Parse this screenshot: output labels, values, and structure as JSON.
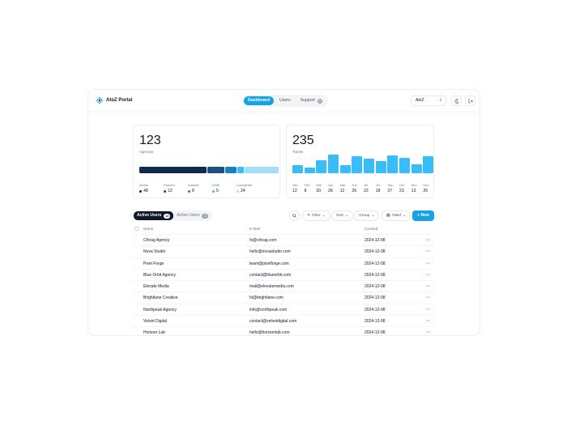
{
  "header": {
    "brand": "AtoZ Portal",
    "nav": [
      {
        "label": "Dashboard",
        "active": true
      },
      {
        "label": "Users",
        "active": false
      },
      {
        "label": "Support",
        "active": false,
        "badge": "3"
      }
    ],
    "org": "AtoZ"
  },
  "agencies_card": {
    "value": "123",
    "label": "Agencies",
    "statuses": [
      {
        "name": "Active",
        "value": "48",
        "color": "#0f2a4d"
      },
      {
        "name": "Paused",
        "value": "12",
        "color": "#1d4f7a"
      },
      {
        "name": "Inactive",
        "value": "8",
        "color": "#1d7fb8"
      },
      {
        "name": "Draft",
        "value": "5",
        "color": "#38bdf8"
      },
      {
        "name": "Completed",
        "value": "24",
        "color": "#a5dcf7"
      }
    ]
  },
  "tickets_card": {
    "value": "235",
    "label": "Tickets",
    "months": [
      {
        "name": "Jan",
        "value": 12
      },
      {
        "name": "Feb",
        "value": 8
      },
      {
        "name": "Mar",
        "value": 20
      },
      {
        "name": "Apr",
        "value": 28
      },
      {
        "name": "Mar",
        "value": 12
      },
      {
        "name": "Jun",
        "value": 26
      },
      {
        "name": "Jul",
        "value": 22
      },
      {
        "name": "Jul",
        "value": 18
      },
      {
        "name": "Sep",
        "value": 27
      },
      {
        "name": "Oct",
        "value": 23
      },
      {
        "name": "Nov",
        "value": 13
      },
      {
        "name": "Dec",
        "value": 26
      }
    ],
    "bar_color": "#38bdf8"
  },
  "toolbar": {
    "tabs": [
      {
        "label": "Active Users",
        "count": "12",
        "active": true
      },
      {
        "label": "Active Users",
        "count": "4",
        "active": false
      }
    ],
    "filter": "Filter",
    "sort": "Sort",
    "group": "Group",
    "view": "Tabel",
    "new": "+ New"
  },
  "table": {
    "columns": [
      "Name",
      "E-Mail",
      "Created"
    ],
    "rows": [
      {
        "name": "Chirag Agency",
        "email": "hi@chirag.com",
        "created": "2024-12-08"
      },
      {
        "name": "Nova Studio",
        "email": "hello@novastudio.com",
        "created": "2024-12-08"
      },
      {
        "name": "Pixel Forge",
        "email": "team@pixelforge.com",
        "created": "2024-12-08"
      },
      {
        "name": "Blue Orbit Agency",
        "email": "contact@blueorbit.com",
        "created": "2024-12-08"
      },
      {
        "name": "Elevate Media",
        "email": "mail@elevatemedia.com",
        "created": "2024-12-08"
      },
      {
        "name": "Brightlane Creative",
        "email": "hi@brightlane.com",
        "created": "2024-12-08"
      },
      {
        "name": "Northpeak Agency",
        "email": "info@northpeak.com",
        "created": "2024-12-08"
      },
      {
        "name": "Velvet Digital",
        "email": "contact@velvetdigital.com",
        "created": "2024-12-08"
      },
      {
        "name": "Horizon Lab",
        "email": "hello@horizonlab.com",
        "created": "2024-12-08"
      }
    ],
    "more": "···"
  },
  "colors": {
    "accent": "#16a2e6",
    "dark": "#111827"
  }
}
